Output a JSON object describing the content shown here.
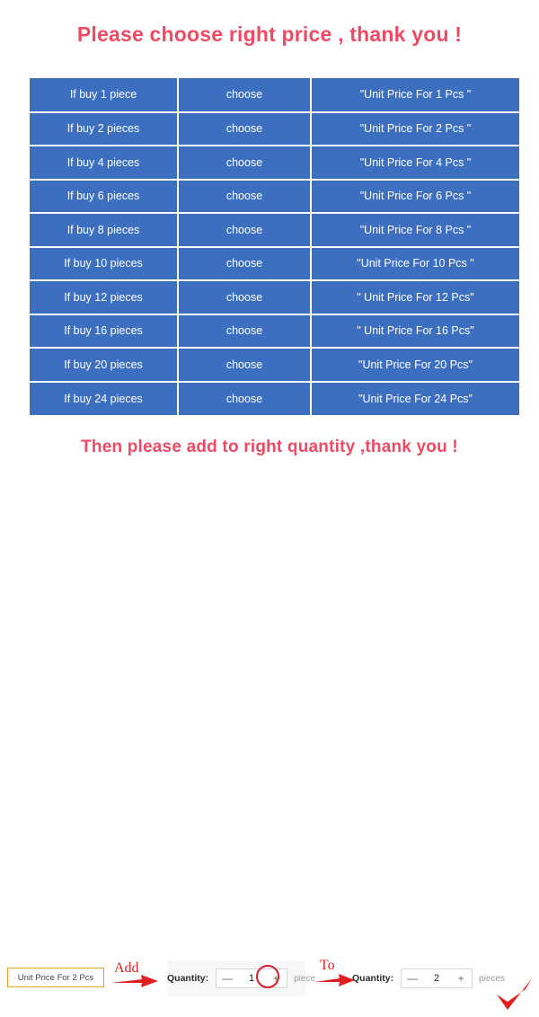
{
  "headings": {
    "top": "Please choose right price , thank you !",
    "bottom": "Then please add to right quantity ,thank you !"
  },
  "colors": {
    "headline_red": "#ef4a63",
    "table_blue": "#3d6fc0",
    "table_text": "#ffffff",
    "badge_border_orange": "#e8a317",
    "annotation_red": "#e02020",
    "highlight_circle_red": "#d81b2c",
    "page_background": "#ffffff"
  },
  "price_table": {
    "rows": [
      {
        "quantity": "If buy  1  piece",
        "action": "choose",
        "price": "\"Unit Price For  1  Pcs \""
      },
      {
        "quantity": "If buy  2  pieces",
        "action": "choose",
        "price": "\"Unit Price For  2  Pcs \""
      },
      {
        "quantity": "If buy  4  pieces",
        "action": "choose",
        "price": "\"Unit Price For  4 Pcs \""
      },
      {
        "quantity": "If buy  6  pieces",
        "action": "choose",
        "price": "\"Unit Price For  6  Pcs \""
      },
      {
        "quantity": "If buy  8  pieces",
        "action": "choose",
        "price": "\"Unit Price For  8  Pcs \""
      },
      {
        "quantity": "If buy  10  pieces",
        "action": "choose",
        "price": "\"Unit Price For  10  Pcs \""
      },
      {
        "quantity": "If buy  12  pieces",
        "action": "choose",
        "price": "\" Unit Price For  12 Pcs\""
      },
      {
        "quantity": "If buy  16  pieces",
        "action": "choose",
        "price": "\" Unit Price For  16  Pcs\""
      },
      {
        "quantity": "If buy  20  pieces",
        "action": "choose",
        "price": "\"Unit Price For  20  Pcs\""
      },
      {
        "quantity": "If buy  24  pieces",
        "action": "choose",
        "price": "\"Unit Price For  24  Pcs\""
      }
    ]
  },
  "bottom_bar": {
    "price_badge": "Unit Price For 2 Pcs",
    "annotation_add": "Add",
    "annotation_to": "To",
    "arrow_icon_name": "right-arrow-icon",
    "check_icon_name": "check-mark-icon",
    "stepper_before": {
      "label": "Quantity:",
      "minus": "—",
      "value": "1",
      "plus": "+",
      "unit": "piece"
    },
    "stepper_after": {
      "label": "Quantity:",
      "minus": "—",
      "value": "2",
      "plus": "+",
      "unit": "pieces"
    }
  }
}
